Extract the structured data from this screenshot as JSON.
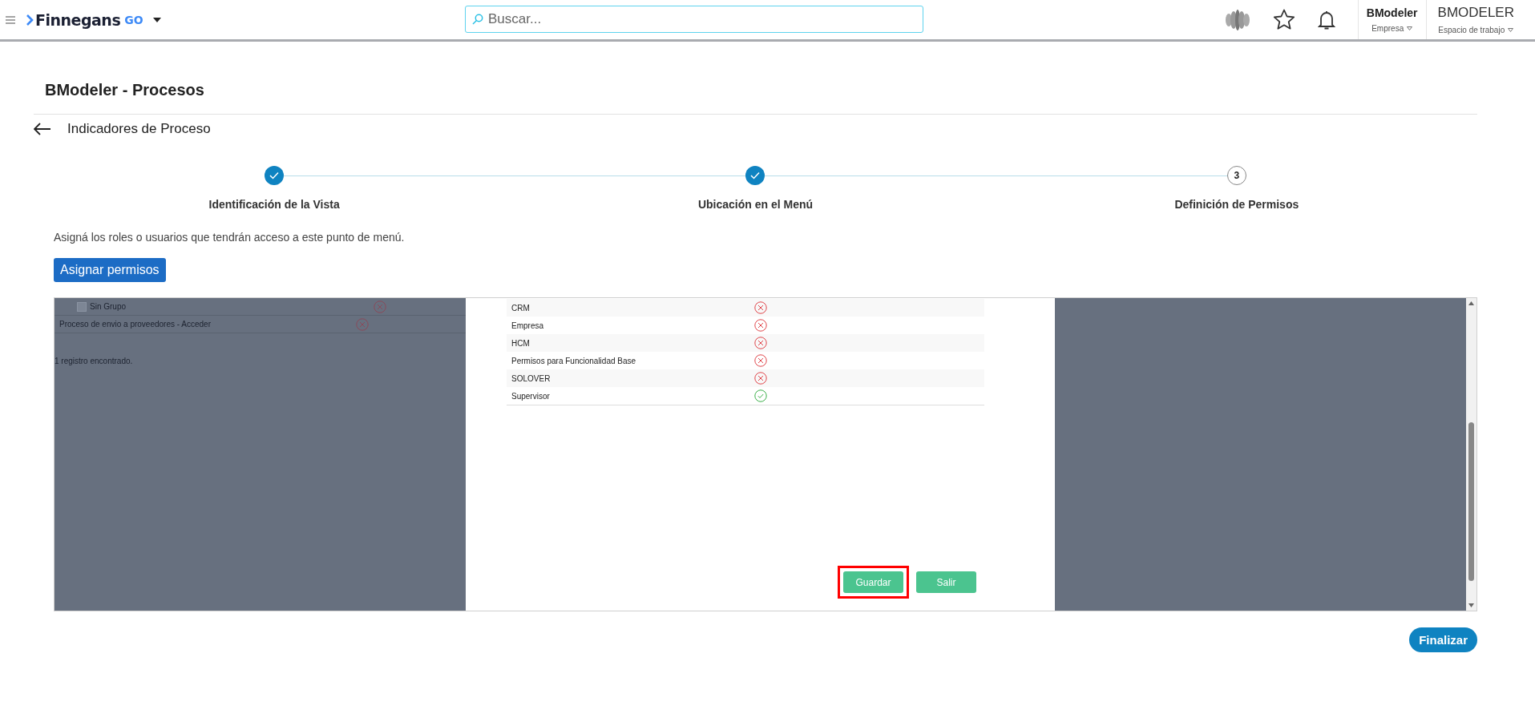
{
  "header": {
    "brand": "Finnegans",
    "brand_suffix": "GO",
    "search": {
      "placeholder": "Buscar..."
    },
    "company": {
      "name": "BModeler",
      "label": "Empresa"
    },
    "workspace": {
      "name": "BMODELER",
      "label": "Espacio de trabajo"
    }
  },
  "page": {
    "title": "BModeler - Procesos",
    "subtitle": "Indicadores de Proceso"
  },
  "steps": [
    {
      "label": "Identificación de la Vista",
      "completed": true
    },
    {
      "label": "Ubicación en el Menú",
      "completed": true
    },
    {
      "label": "Definición de Permisos",
      "completed": false,
      "number": "3"
    }
  ],
  "instructions": "Asigná los roles o usuarios que tendrán acceso a este punto de menú.",
  "assign_button": "Asignar permisos",
  "background_list": {
    "rows": [
      {
        "kind": "group",
        "label": "Sin Grupo",
        "granted": false
      },
      {
        "kind": "item",
        "label": "Proceso de envio a proveedores - Acceder",
        "granted": false
      }
    ],
    "count": "1 registro encontrado."
  },
  "permissions": [
    {
      "role": "CRM",
      "granted": false
    },
    {
      "role": "Empresa",
      "granted": false
    },
    {
      "role": "HCM",
      "granted": false
    },
    {
      "role": "Permisos para Funcionalidad Base",
      "granted": false
    },
    {
      "role": "SOLOVER",
      "granted": false
    },
    {
      "role": "Supervisor",
      "granted": true
    }
  ],
  "modal_buttons": [
    {
      "label": "Guardar",
      "highlighted": true
    },
    {
      "label": "Salir",
      "highlighted": false
    }
  ],
  "finish_button": "Finalizar"
}
